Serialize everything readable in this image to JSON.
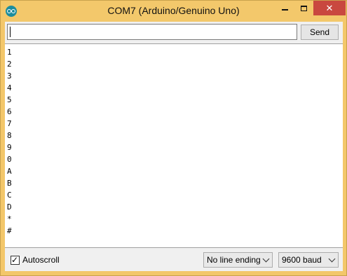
{
  "window": {
    "title": "COM7 (Arduino/Genuino Uno)",
    "close_glyph": "✕"
  },
  "input_bar": {
    "value": "",
    "send_label": "Send"
  },
  "output": {
    "lines": [
      "1",
      "2",
      "3",
      "4",
      "5",
      "6",
      "7",
      "8",
      "9",
      "0",
      "A",
      "B",
      "C",
      "D",
      "*",
      "#"
    ]
  },
  "statusbar": {
    "autoscroll_label": "Autoscroll",
    "autoscroll_checked": true,
    "line_ending": "No line ending",
    "baud_rate": "9600 baud"
  },
  "colors": {
    "titlebar": "#f3c86b",
    "close_button": "#c9483f",
    "app_icon": "#1c8d9e"
  }
}
